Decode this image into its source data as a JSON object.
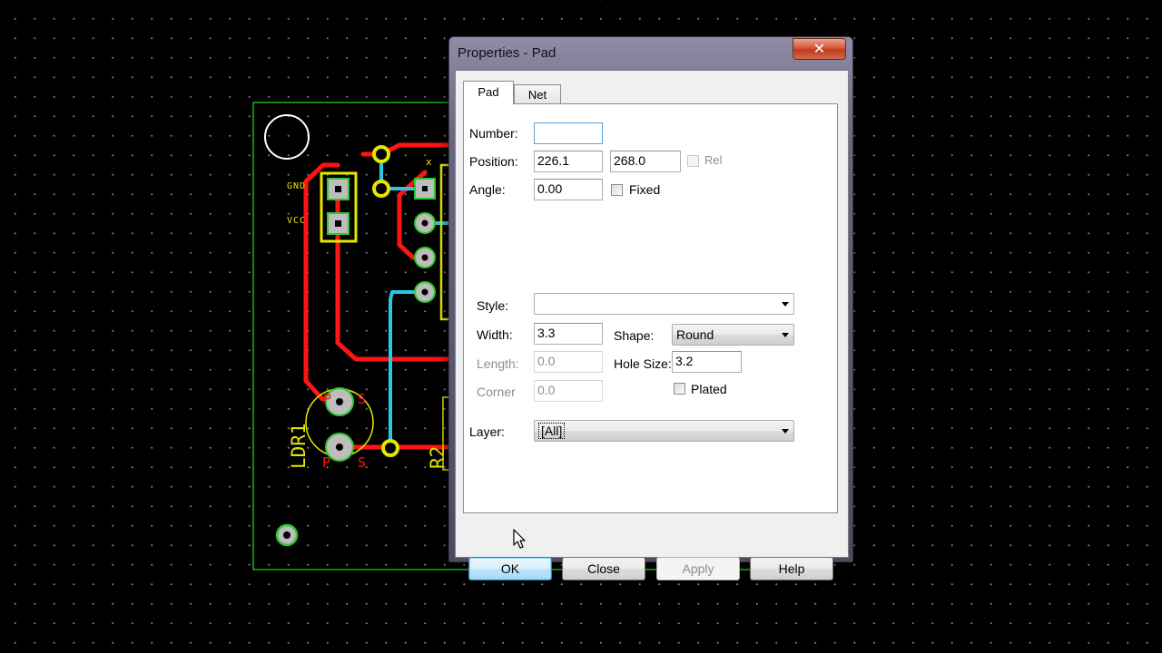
{
  "pcb": {
    "labels": {
      "gnd": "GND",
      "vcc": "VCC",
      "ldr": "LDR1",
      "r2": "R2",
      "p_top": "P",
      "s_top": "S",
      "p_bottom": "P",
      "s_bottom": "S",
      "x_mark": "x"
    },
    "colors": {
      "board_outline": "#19d219",
      "copper_track": "#ff1414",
      "blue_track": "#27c7e6",
      "silkscreen": "#e6e600",
      "pad": "#bdbdbd",
      "pad_ring": "#2bc92b"
    }
  },
  "dialog": {
    "title": "Properties - Pad",
    "close_glyph": "✕",
    "tabs": [
      {
        "label": "Pad",
        "active": true
      },
      {
        "label": "Net",
        "active": false
      }
    ],
    "fields": {
      "number_label": "Number:",
      "number_value": "",
      "position_label": "Position:",
      "position_x": "226.1",
      "position_y": "268.0",
      "rel_label": "Rel",
      "angle_label": "Angle:",
      "angle_value": "0.00",
      "fixed_label": "Fixed",
      "style_label": "Style:",
      "style_value": "",
      "width_label": "Width:",
      "width_value": "3.3",
      "shape_label": "Shape:",
      "shape_value": "Round",
      "length_label": "Length:",
      "length_value": "0.0",
      "hole_size_label": "Hole Size:",
      "hole_size_value": "3.2",
      "corner_label": "Corner",
      "corner_value": "0.0",
      "plated_label": "Plated",
      "layer_label": "Layer:",
      "layer_value": "[All]"
    },
    "checkboxes": {
      "rel": false,
      "fixed": false,
      "plated": false
    },
    "buttons": {
      "ok": "OK",
      "close": "Close",
      "apply": "Apply",
      "help": "Help"
    }
  }
}
